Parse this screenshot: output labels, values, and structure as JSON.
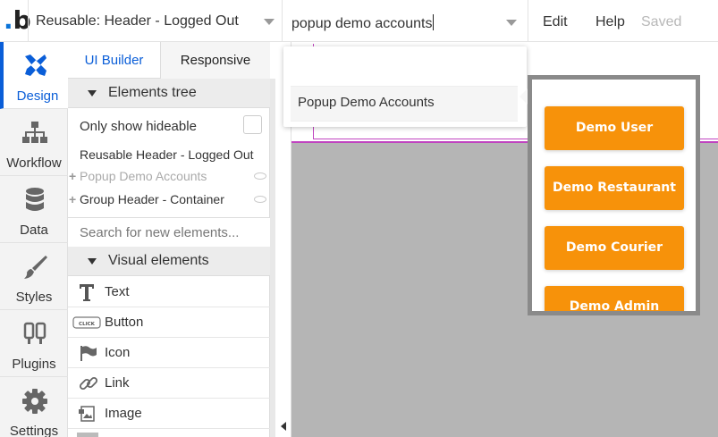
{
  "topbar": {
    "logo_letter": "b",
    "logo_dot": ".",
    "page_name": "Reusable: Header - Logged Out",
    "element_search": "popup demo accounts",
    "menu": {
      "edit": "Edit",
      "help": "Help",
      "status": "Saved"
    }
  },
  "rail": {
    "items": [
      {
        "label": "Design",
        "icon": "design-icon"
      },
      {
        "label": "Workflow",
        "icon": "workflow-icon"
      },
      {
        "label": "Data",
        "icon": "database-icon"
      },
      {
        "label": "Styles",
        "icon": "brush-icon"
      },
      {
        "label": "Plugins",
        "icon": "plug-icon"
      },
      {
        "label": "Settings",
        "icon": "gear-icon"
      }
    ]
  },
  "panel": {
    "tabs": {
      "ui_builder": "UI Builder",
      "responsive": "Responsive"
    },
    "elements_tree": {
      "title": "Elements tree",
      "only_hideable": "Only show hideable",
      "items": [
        "Reusable Header - Logged Out",
        "Popup Demo Accounts",
        "Group Header - Container"
      ]
    },
    "search_placeholder": "Search for new elements...",
    "visual_elements": {
      "title": "Visual elements",
      "items": [
        {
          "label": "Text",
          "icon": "text-icon"
        },
        {
          "label": "Button",
          "icon": "button-icon",
          "icon_text": "CLICK"
        },
        {
          "label": "Icon",
          "icon": "flag-icon"
        },
        {
          "label": "Link",
          "icon": "link-icon"
        },
        {
          "label": "Image",
          "icon": "image-icon"
        }
      ]
    }
  },
  "dropdown": {
    "result": "Popup Demo Accounts"
  },
  "popup": {
    "buttons": [
      "Demo User",
      "Demo Restaurant",
      "Demo Courier",
      "Demo Admin"
    ]
  },
  "colors": {
    "accent": "#0a5ed8",
    "orange_button": "#f7920a",
    "selection_outline": "#c043c0",
    "canvas_bg": "#b5b5b5"
  }
}
